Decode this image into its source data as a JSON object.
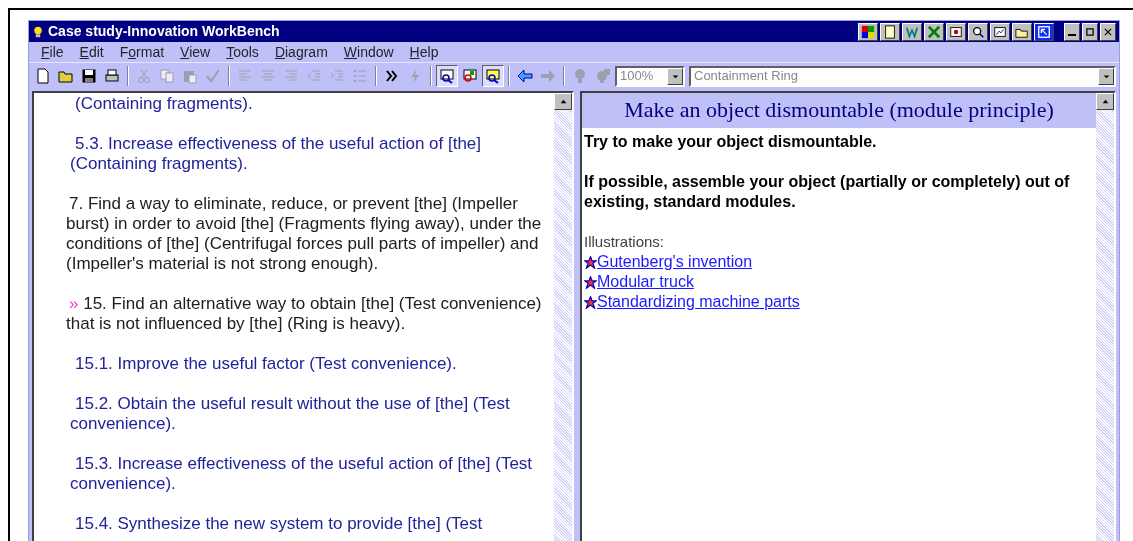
{
  "window": {
    "title": "Case study-Innovation WorkBench",
    "title_tools": [
      {
        "kind": "palette"
      },
      {
        "kind": "notepad"
      },
      {
        "kind": "word"
      },
      {
        "kind": "excel"
      },
      {
        "kind": "slide"
      },
      {
        "kind": "search"
      },
      {
        "kind": "chart"
      },
      {
        "kind": "folder"
      },
      {
        "kind": "jump",
        "selected": true
      }
    ]
  },
  "menu": [
    {
      "key": "F",
      "rest": "ile"
    },
    {
      "key": "E",
      "rest": "dit"
    },
    {
      "lead": "F",
      "key": "o",
      "rest": "rmat"
    },
    {
      "key": "V",
      "rest": "iew"
    },
    {
      "key": "T",
      "rest": "ools"
    },
    {
      "key": "D",
      "rest": "iagram"
    },
    {
      "key": "W",
      "rest": "indow"
    },
    {
      "key": "H",
      "rest": "elp"
    }
  ],
  "toolbar": [
    {
      "kind": "new",
      "disabled": false
    },
    {
      "kind": "open",
      "disabled": false
    },
    {
      "kind": "save",
      "disabled": false
    },
    {
      "kind": "print",
      "disabled": false
    },
    {
      "kind": "sep"
    },
    {
      "kind": "cut",
      "disabled": true
    },
    {
      "kind": "copy",
      "disabled": true
    },
    {
      "kind": "paste",
      "disabled": true
    },
    {
      "kind": "spell",
      "disabled": true
    },
    {
      "kind": "sep"
    },
    {
      "kind": "align",
      "disabled": true
    },
    {
      "kind": "center",
      "disabled": true
    },
    {
      "kind": "right",
      "disabled": true
    },
    {
      "kind": "outdent",
      "disabled": true
    },
    {
      "kind": "indent",
      "disabled": true
    },
    {
      "kind": "list",
      "disabled": true
    },
    {
      "kind": "sep"
    },
    {
      "kind": "forward",
      "disabled": false
    },
    {
      "kind": "bolt",
      "disabled": true
    },
    {
      "kind": "sep"
    },
    {
      "kind": "view",
      "disabled": false,
      "pressed": true
    },
    {
      "kind": "view2",
      "disabled": false,
      "pressed": false
    },
    {
      "kind": "view3",
      "disabled": false,
      "pressed": true
    },
    {
      "kind": "sep"
    },
    {
      "kind": "back",
      "disabled": false
    },
    {
      "kind": "next",
      "disabled": true
    },
    {
      "kind": "sep"
    },
    {
      "kind": "bulb",
      "disabled": true
    },
    {
      "kind": "bulb2",
      "disabled": true
    }
  ],
  "zoom": {
    "value": "100%"
  },
  "topic": {
    "value": "Containment Ring"
  },
  "left_pane": {
    "items": [
      {
        "kind": "sub",
        "text": "(Containing fragments)."
      },
      {
        "kind": "sub",
        "text": "5.3. Increase effectiveness of the useful action of [the] (Containing fragments)."
      },
      {
        "kind": "main",
        "text": "7. Find a way to eliminate, reduce, or prevent [the] (Impeller burst) in order to avoid [the] (Fragments flying away), under the conditions of [the] (Centrifugal forces pull parts of impeller) and (Impeller's material is not strong enough)."
      },
      {
        "kind": "main",
        "text": "15. Find an alternative way to obtain [the] (Test convenience) that is not influenced by [the] (Ring is heavy).",
        "marker": "»"
      },
      {
        "kind": "sub",
        "text": "15.1. Improve the useful factor (Test convenience)."
      },
      {
        "kind": "sub",
        "text": "15.2. Obtain the useful result without the use of [the] (Test convenience)."
      },
      {
        "kind": "sub",
        "text": "15.3. Increase effectiveness of the useful action of [the] (Test convenience)."
      },
      {
        "kind": "sub",
        "text": "15.4. Synthesize the new system to provide [the] (Test"
      }
    ]
  },
  "right_pane": {
    "heading": "Make an object dismountable (module principle)",
    "paragraphs": [
      "Try to make your object dismountable.",
      "If possible, assemble your object (partially or completely) out of existing, standard modules."
    ],
    "illustrations_label": "Illustrations:",
    "links": [
      "Gutenberg's invention",
      "Modular truck",
      "Standardizing machine parts"
    ]
  }
}
